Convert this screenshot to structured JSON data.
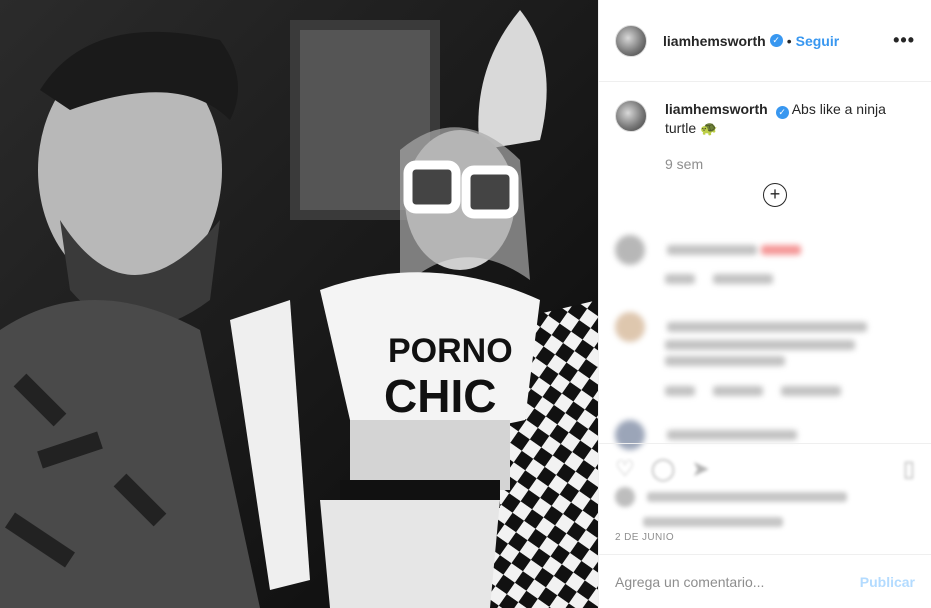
{
  "post": {
    "username": "liamhemsworth",
    "verified_icon": "verified-badge-icon",
    "follow_label": "Seguir",
    "separator": "•",
    "more_label": "•••",
    "caption_text": "Abs like a ninja turtle 🐢",
    "time_ago": "9 sem",
    "load_more_label": "+",
    "date": "2 DE JUNIO",
    "photo_text_line1": "PORNO",
    "photo_text_line2": "CHIC"
  },
  "comment_bar": {
    "placeholder": "Agrega un comentario...",
    "publish_label": "Publicar"
  },
  "colors": {
    "accent": "#3897f0",
    "publish_disabled": "#b3dbff",
    "muted": "#8e8e8e"
  }
}
